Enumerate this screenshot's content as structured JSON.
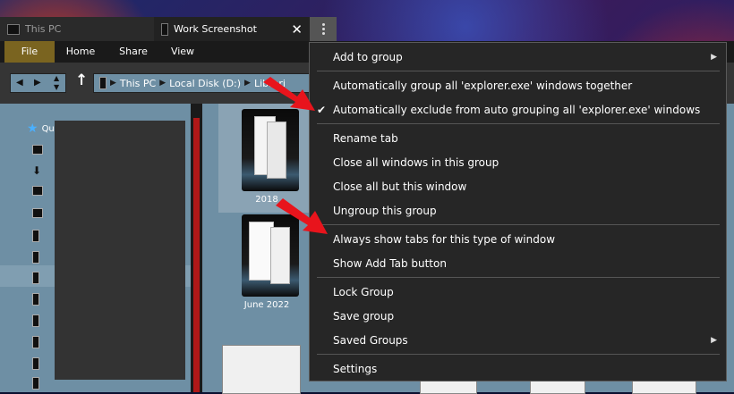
{
  "tabs": [
    {
      "label": "This PC",
      "active": false
    },
    {
      "label": "Work Screenshot",
      "active": true
    }
  ],
  "ribbon": {
    "tabs": [
      "File",
      "Home",
      "Share",
      "View"
    ]
  },
  "address": {
    "crumbs": [
      "This PC",
      "Local Disk (D:)",
      "Librari"
    ]
  },
  "navpane": {
    "quick_access": "Quick access"
  },
  "folders": [
    {
      "label": "2018"
    },
    {
      "label": "June 2022"
    }
  ],
  "menu": {
    "items": [
      {
        "label": "Add to group",
        "submenu": true
      },
      {
        "label": "Automatically group all 'explorer.exe' windows together"
      },
      {
        "label": "Automatically exclude from auto grouping all 'explorer.exe' windows",
        "checked": true
      },
      {
        "label": "Rename tab"
      },
      {
        "label": "Close all windows in this group"
      },
      {
        "label": "Close all but this window"
      },
      {
        "label": "Ungroup this group"
      },
      {
        "label": "Always show tabs for this type of window"
      },
      {
        "label": "Show Add Tab button"
      },
      {
        "label": "Lock Group"
      },
      {
        "label": "Save group"
      },
      {
        "label": "Saved Groups",
        "submenu": true
      },
      {
        "label": "Settings"
      }
    ]
  },
  "colors": {
    "menu_bg": "#262626",
    "pane_bg": "#6e8fa4",
    "annotation_arrow": "#e8141c",
    "file_tab": "#7a6420"
  }
}
